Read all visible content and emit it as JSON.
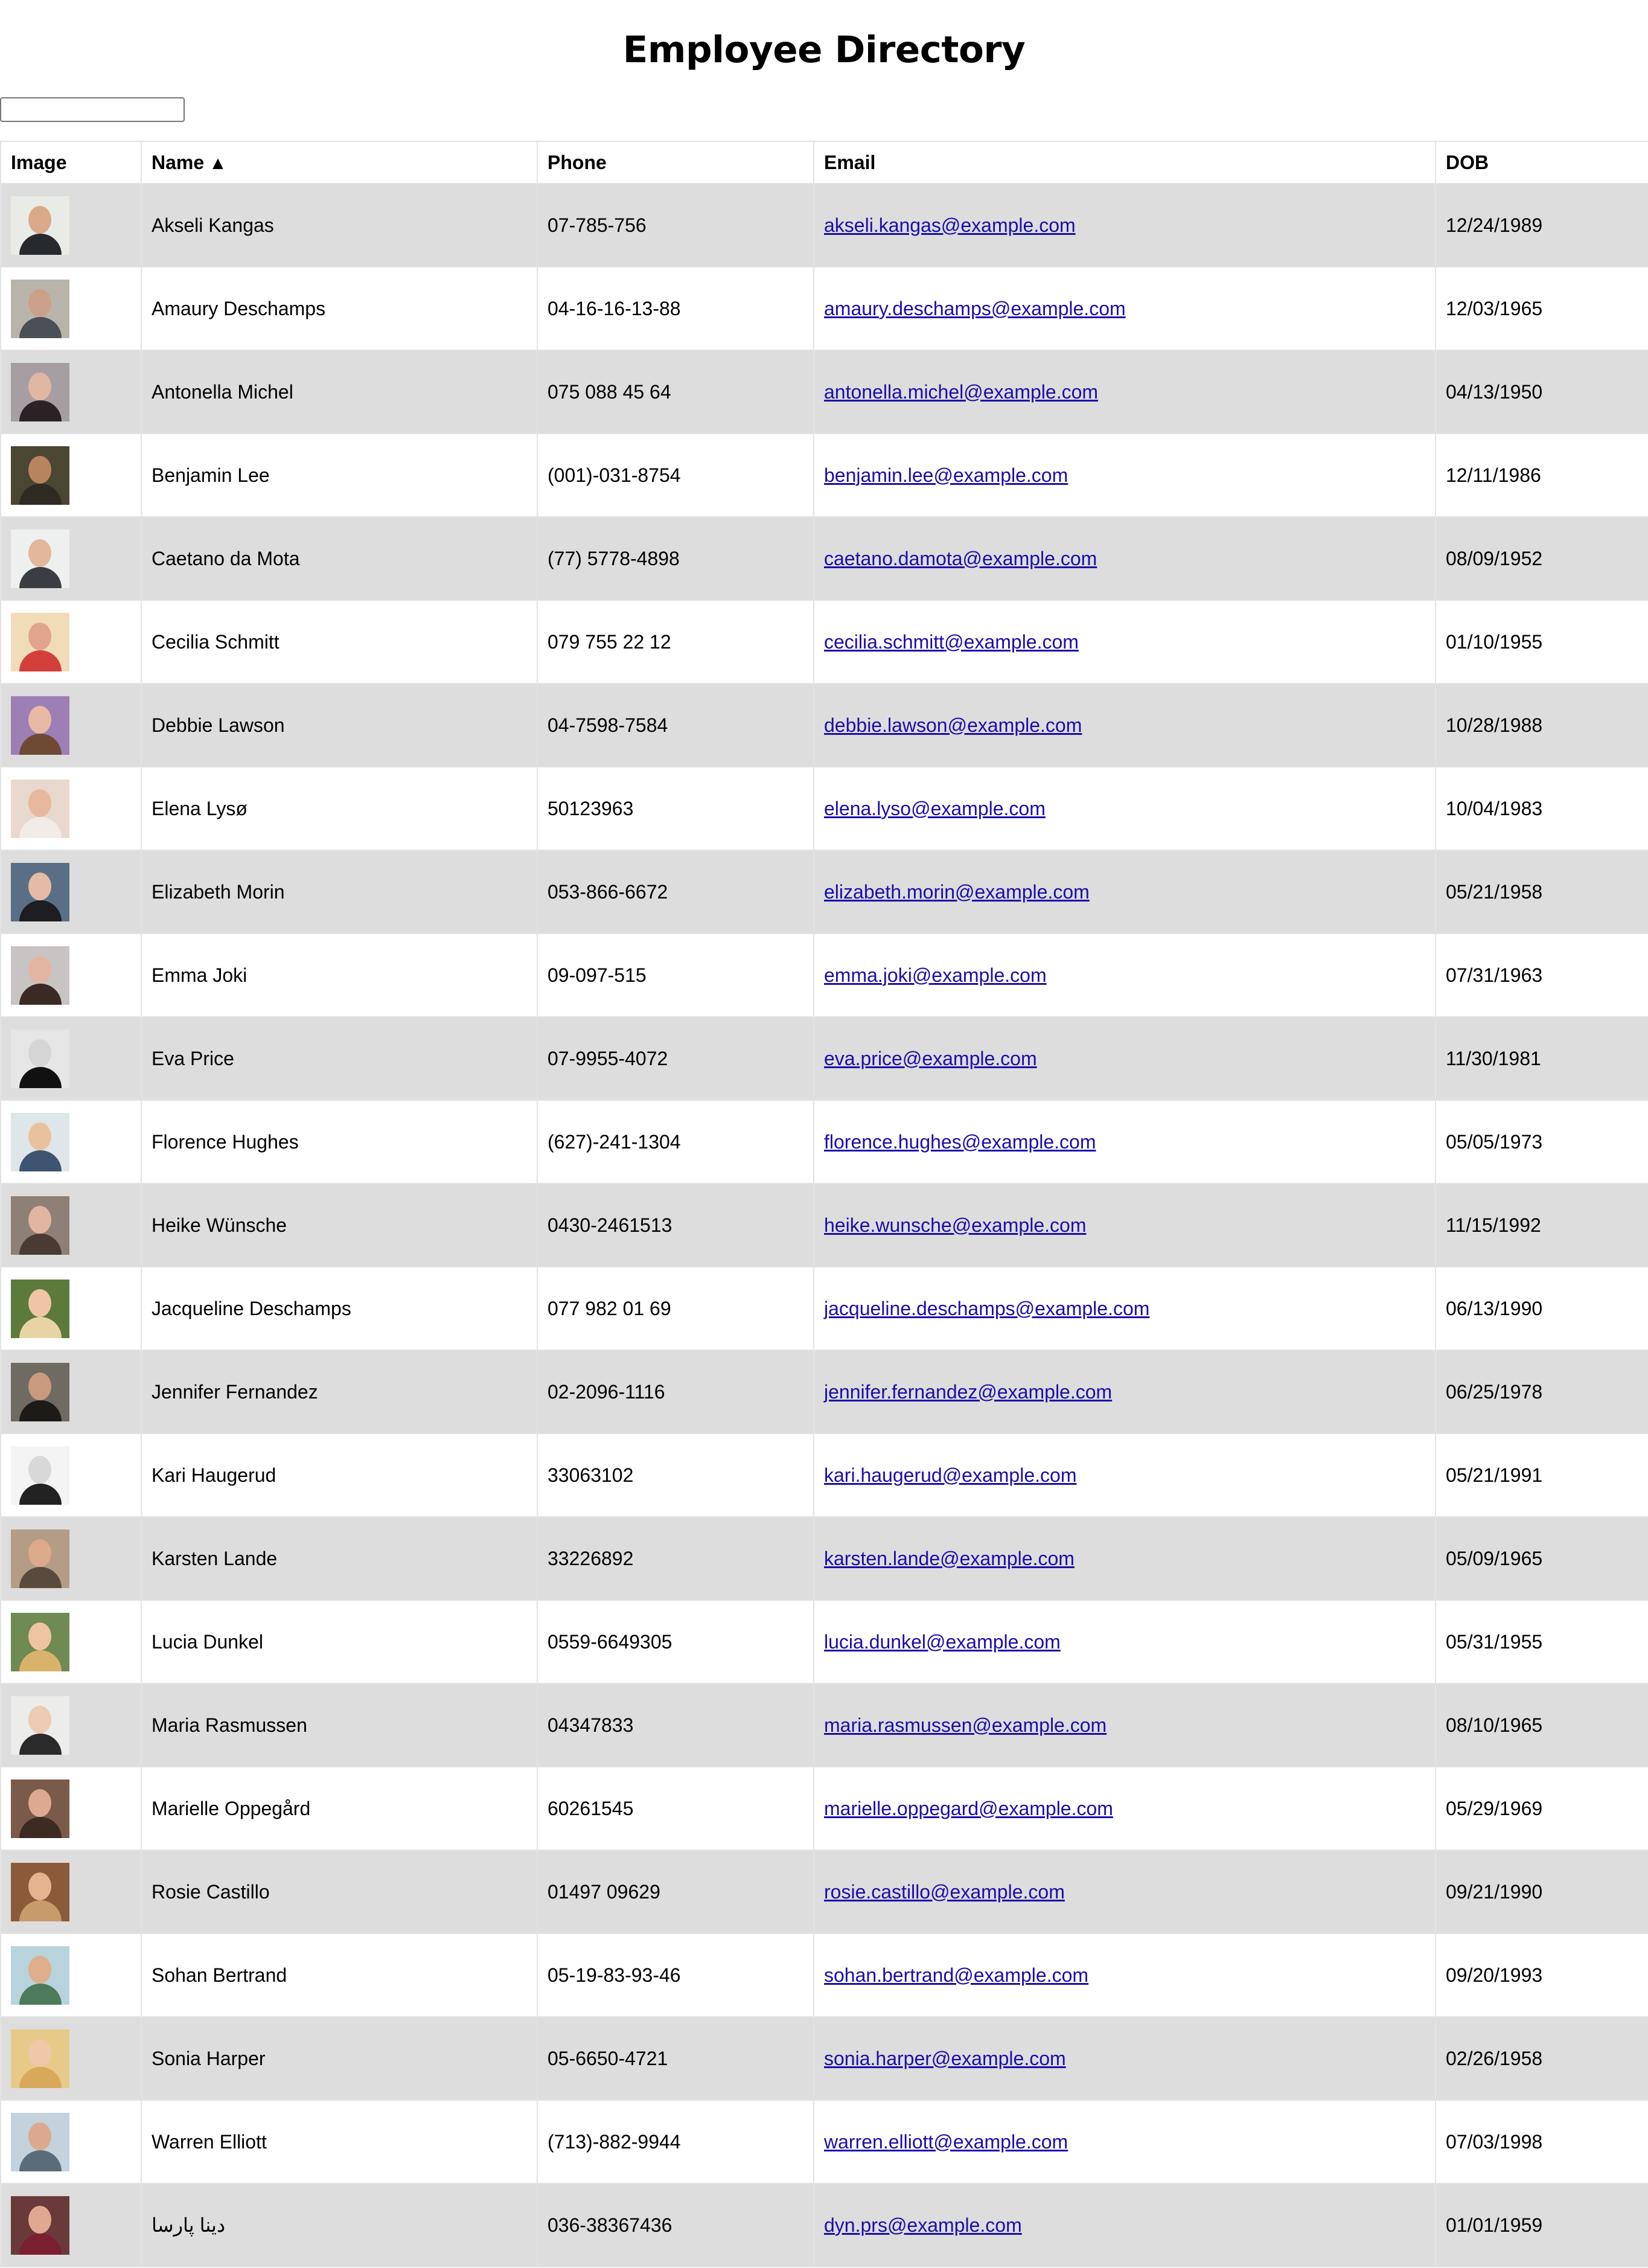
{
  "page": {
    "title": "Employee Directory",
    "search": {
      "value": "",
      "placeholder": ""
    }
  },
  "table": {
    "headers": {
      "image": "Image",
      "name": "Name",
      "name_sort_indicator": "▲",
      "phone": "Phone",
      "email": "Email",
      "dob": "DOB"
    },
    "rows": [
      {
        "name": "Akseli Kangas",
        "phone": "07-785-756",
        "email": "akseli.kangas@example.com",
        "dob": "12/24/1989",
        "avatar": {
          "bg": "#e9ece6",
          "skin": "#d9a98a",
          "shirt": "#26292e"
        }
      },
      {
        "name": "Amaury Deschamps",
        "phone": "04-16-16-13-88",
        "email": "amaury.deschamps@example.com",
        "dob": "12/03/1965",
        "avatar": {
          "bg": "#b8b4ab",
          "skin": "#caa088",
          "shirt": "#4b4f56"
        }
      },
      {
        "name": "Antonella Michel",
        "phone": "075 088 45 64",
        "email": "antonella.michel@example.com",
        "dob": "04/13/1950",
        "avatar": {
          "bg": "#a79ea3",
          "skin": "#e0b7a3",
          "shirt": "#2b2226"
        }
      },
      {
        "name": "Benjamin Lee",
        "phone": "(001)-031-8754",
        "email": "benjamin.lee@example.com",
        "dob": "12/11/1986",
        "avatar": {
          "bg": "#4a4632",
          "skin": "#b8845f",
          "shirt": "#2f2a22"
        }
      },
      {
        "name": "Caetano da Mota",
        "phone": "(77) 5778-4898",
        "email": "caetano.damota@example.com",
        "dob": "08/09/1952",
        "avatar": {
          "bg": "#eef0f0",
          "skin": "#e2b79c",
          "shirt": "#3a3d42"
        }
      },
      {
        "name": "Cecilia Schmitt",
        "phone": "079 755 22 12",
        "email": "cecilia.schmitt@example.com",
        "dob": "01/10/1955",
        "avatar": {
          "bg": "#f1dcb8",
          "skin": "#e1a58d",
          "shirt": "#d3403b"
        }
      },
      {
        "name": "Debbie Lawson",
        "phone": "04-7598-7584",
        "email": "debbie.lawson@example.com",
        "dob": "10/28/1988",
        "avatar": {
          "bg": "#9d7fb6",
          "skin": "#e8b9a4",
          "shirt": "#6e4a34"
        }
      },
      {
        "name": "Elena Lysø",
        "phone": "50123963",
        "email": "elena.lyso@example.com",
        "dob": "10/04/1983",
        "avatar": {
          "bg": "#e9d8cd",
          "skin": "#e6b89e",
          "shirt": "#f2ece8"
        }
      },
      {
        "name": "Elizabeth Morin",
        "phone": "053-866-6672",
        "email": "elizabeth.morin@example.com",
        "dob": "05/21/1958",
        "avatar": {
          "bg": "#5a6f86",
          "skin": "#e3bba6",
          "shirt": "#1e1e22"
        }
      },
      {
        "name": "Emma Joki",
        "phone": "09-097-515",
        "email": "emma.joki@example.com",
        "dob": "07/31/1963",
        "avatar": {
          "bg": "#c9c4c4",
          "skin": "#e2b6a2",
          "shirt": "#3a2a26"
        }
      },
      {
        "name": "Eva Price",
        "phone": "07-9955-4072",
        "email": "eva.price@example.com",
        "dob": "11/30/1981",
        "avatar": {
          "bg": "#e6e6e6",
          "skin": "#d6d6d6",
          "shirt": "#111111"
        }
      },
      {
        "name": "Florence Hughes",
        "phone": "(627)-241-1304",
        "email": "florence.hughes@example.com",
        "dob": "05/05/1973",
        "avatar": {
          "bg": "#dfe6ea",
          "skin": "#e8c29f",
          "shirt": "#3f5470"
        }
      },
      {
        "name": "Heike Wünsche",
        "phone": "0430-2461513",
        "email": "heike.wunsche@example.com",
        "dob": "11/15/1992",
        "avatar": {
          "bg": "#8e7f77",
          "skin": "#e0b6a1",
          "shirt": "#4a3a33"
        }
      },
      {
        "name": "Jacqueline Deschamps",
        "phone": "077 982 01 69",
        "email": "jacqueline.deschamps@example.com",
        "dob": "06/13/1990",
        "avatar": {
          "bg": "#5b7a3c",
          "skin": "#efc5a6",
          "shirt": "#e8d3a5"
        }
      },
      {
        "name": "Jennifer Fernandez",
        "phone": "02-2096-1116",
        "email": "jennifer.fernandez@example.com",
        "dob": "06/25/1978",
        "avatar": {
          "bg": "#6f6a62",
          "skin": "#c99a7d",
          "shirt": "#1e1a18"
        }
      },
      {
        "name": "Kari Haugerud",
        "phone": "33063102",
        "email": "kari.haugerud@example.com",
        "dob": "05/21/1991",
        "avatar": {
          "bg": "#f4f4f4",
          "skin": "#d8d8d8",
          "shirt": "#222222"
        }
      },
      {
        "name": "Karsten Lande",
        "phone": "33226892",
        "email": "karsten.lande@example.com",
        "dob": "05/09/1965",
        "avatar": {
          "bg": "#b49c86",
          "skin": "#dcaa8c",
          "shirt": "#5a4a3e"
        }
      },
      {
        "name": "Lucia Dunkel",
        "phone": "0559-6649305",
        "email": "lucia.dunkel@example.com",
        "dob": "05/31/1955",
        "avatar": {
          "bg": "#6f8a52",
          "skin": "#eec3a2",
          "shirt": "#d9b36c"
        }
      },
      {
        "name": "Maria Rasmussen",
        "phone": "04347833",
        "email": "maria.rasmussen@example.com",
        "dob": "08/10/1965",
        "avatar": {
          "bg": "#ececea",
          "skin": "#eccbb2",
          "shirt": "#2a2a2a"
        }
      },
      {
        "name": "Marielle Oppegård",
        "phone": "60261545",
        "email": "marielle.oppegard@example.com",
        "dob": "05/29/1969",
        "avatar": {
          "bg": "#7a5a4a",
          "skin": "#dcaa90",
          "shirt": "#3d2a22"
        }
      },
      {
        "name": "Rosie Castillo",
        "phone": "01497 09629",
        "email": "rosie.castillo@example.com",
        "dob": "09/21/1990",
        "avatar": {
          "bg": "#8a5a3a",
          "skin": "#e4b38f",
          "shirt": "#c79b6a"
        }
      },
      {
        "name": "Sohan Bertrand",
        "phone": "05-19-83-93-46",
        "email": "sohan.bertrand@example.com",
        "dob": "09/20/1993",
        "avatar": {
          "bg": "#b9d3dc",
          "skin": "#dfae8c",
          "shirt": "#4d7a5a"
        }
      },
      {
        "name": "Sonia Harper",
        "phone": "05-6650-4721",
        "email": "sonia.harper@example.com",
        "dob": "02/26/1958",
        "avatar": {
          "bg": "#e7c98a",
          "skin": "#efc8a8",
          "shirt": "#d8a95a"
        }
      },
      {
        "name": "Warren Elliott",
        "phone": "(713)-882-9944",
        "email": "warren.elliott@example.com",
        "dob": "07/03/1998",
        "avatar": {
          "bg": "#c4d2dd",
          "skin": "#dba98c",
          "shirt": "#5a6b7a"
        }
      },
      {
        "name": "دینا پارسا",
        "phone": "036-38367436",
        "email": "dyn.prs@example.com",
        "dob": "01/01/1959",
        "avatar": {
          "bg": "#6a3a3a",
          "skin": "#e0a890",
          "shirt": "#7a2030"
        }
      }
    ]
  }
}
